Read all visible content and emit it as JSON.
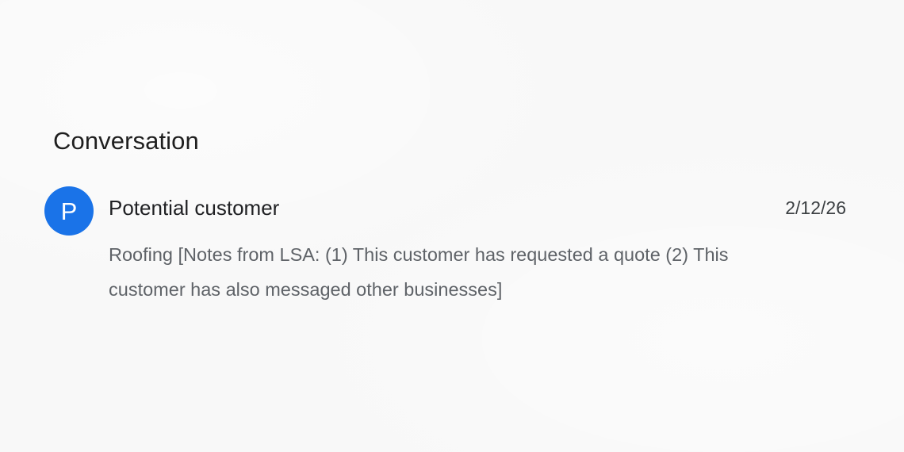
{
  "section": {
    "title": "Conversation"
  },
  "conversation": {
    "avatar_initial": "P",
    "name": "Potential customer",
    "date": "2/12/26",
    "preview": "Roofing [Notes from LSA: (1) This customer has requested a quote (2) This customer has also messaged other businesses]",
    "avatar_color": "#1a73e8"
  },
  "icons": {
    "avatar": "avatar-initial-icon"
  }
}
